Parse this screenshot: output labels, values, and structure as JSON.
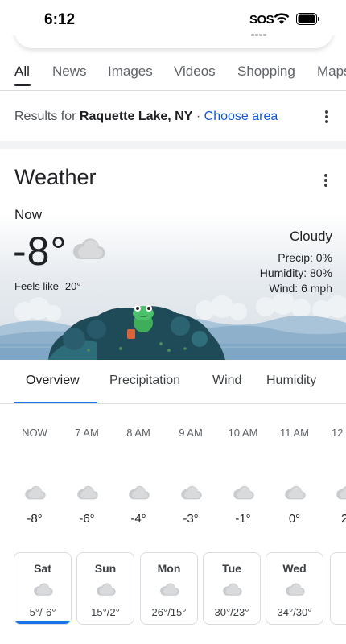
{
  "status": {
    "time": "6:12",
    "sos": "SOS"
  },
  "tabs": [
    "All",
    "News",
    "Images",
    "Videos",
    "Shopping",
    "Maps"
  ],
  "results": {
    "prefix": "Results for",
    "location": "Raquette Lake, NY",
    "separator": "·",
    "choose_area": "Choose area"
  },
  "weather": {
    "title": "Weather",
    "now_label": "Now",
    "temperature": "-8°",
    "feels_like": "Feels like -20°",
    "condition": "Cloudy",
    "precip": "Precip: 0%",
    "humidity": "Humidity: 80%",
    "wind": "Wind: 6 mph"
  },
  "forecast_tabs": [
    "Overview",
    "Precipitation",
    "Wind",
    "Humidity"
  ],
  "hourly": [
    {
      "time": "NOW",
      "temp": "-8°",
      "icon": "cloud-icon"
    },
    {
      "time": "7 AM",
      "temp": "-6°",
      "icon": "cloud-icon"
    },
    {
      "time": "8 AM",
      "temp": "-4°",
      "icon": "cloud-icon"
    },
    {
      "time": "9 AM",
      "temp": "-3°",
      "icon": "cloud-icon"
    },
    {
      "time": "10 AM",
      "temp": "-1°",
      "icon": "cloud-icon"
    },
    {
      "time": "11 AM",
      "temp": "0°",
      "icon": "cloud-icon"
    },
    {
      "time": "12",
      "temp": "2",
      "icon": "cloud-icon"
    }
  ],
  "daily": [
    {
      "day": "Sat",
      "temps": "5°/-6°",
      "icon": "cloud-icon",
      "selected": true
    },
    {
      "day": "Sun",
      "temps": "15°/2°",
      "icon": "cloud-icon"
    },
    {
      "day": "Mon",
      "temps": "26°/15°",
      "icon": "cloud-icon"
    },
    {
      "day": "Tue",
      "temps": "30°/23°",
      "icon": "cloud-icon"
    },
    {
      "day": "Wed",
      "temps": "34°/30°",
      "icon": "cloud-icon"
    }
  ],
  "colors": {
    "accent": "#1a73e8",
    "link": "#1558d6",
    "text": "#202124",
    "muted": "#5f6368"
  }
}
